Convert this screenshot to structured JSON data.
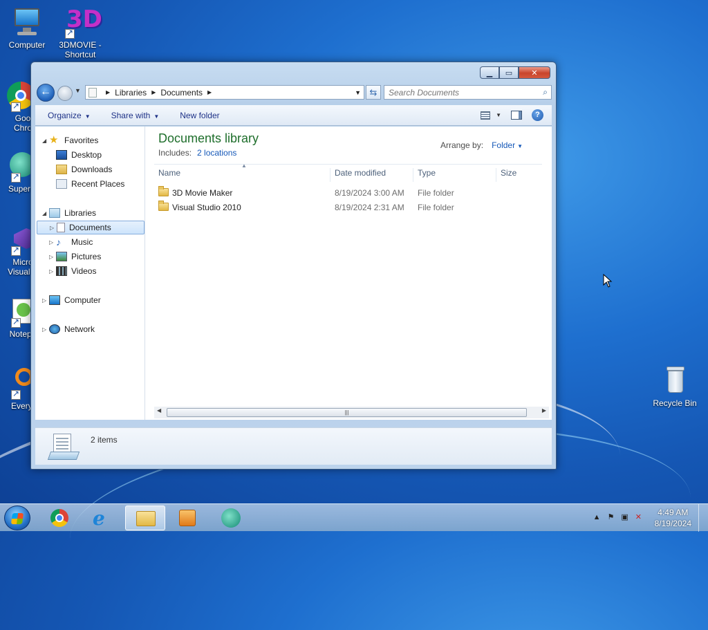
{
  "desktop": {
    "icons": [
      {
        "label": "Computer"
      },
      {
        "label": "3DMOVIE -\nShortcut",
        "line1": "3DMOVIE -",
        "line2": "Shortcut"
      },
      {
        "label": "Goo\nChro",
        "line1": "Goo",
        "line2": "Chro"
      },
      {
        "label": "Superm",
        "line1": "Superm"
      },
      {
        "label": "Micro\nVisual S",
        "line1": "Micro",
        "line2": "Visual S"
      },
      {
        "label": "Notepa",
        "line1": "Notepa"
      },
      {
        "label": "Everyt",
        "line1": "Everyt"
      },
      {
        "label": "Recycle Bin"
      }
    ]
  },
  "window": {
    "title": "Documents",
    "breadcrumb": [
      "Libraries",
      "Documents"
    ],
    "search_placeholder": "Search Documents",
    "toolbar": {
      "organize": "Organize",
      "share_with": "Share with",
      "new_folder": "New folder"
    },
    "nav": {
      "favorites": "Favorites",
      "desktop": "Desktop",
      "downloads": "Downloads",
      "recent_places": "Recent Places",
      "libraries": "Libraries",
      "documents": "Documents",
      "music": "Music",
      "pictures": "Pictures",
      "videos": "Videos",
      "computer": "Computer",
      "network": "Network"
    },
    "library": {
      "title": "Documents library",
      "includes_label": "Includes:",
      "includes_link": "2 locations",
      "arrange_label": "Arrange by:",
      "arrange_value": "Folder"
    },
    "columns": {
      "name": "Name",
      "date": "Date modified",
      "type": "Type",
      "size": "Size"
    },
    "files": [
      {
        "name": "3D Movie Maker",
        "date": "8/19/2024 3:00 AM",
        "type": "File folder"
      },
      {
        "name": "Visual Studio 2010",
        "date": "8/19/2024 2:31 AM",
        "type": "File folder"
      }
    ],
    "status": {
      "count": "2 items"
    }
  },
  "taskbar": {
    "time": "4:49 AM",
    "date": "8/19/2024"
  }
}
